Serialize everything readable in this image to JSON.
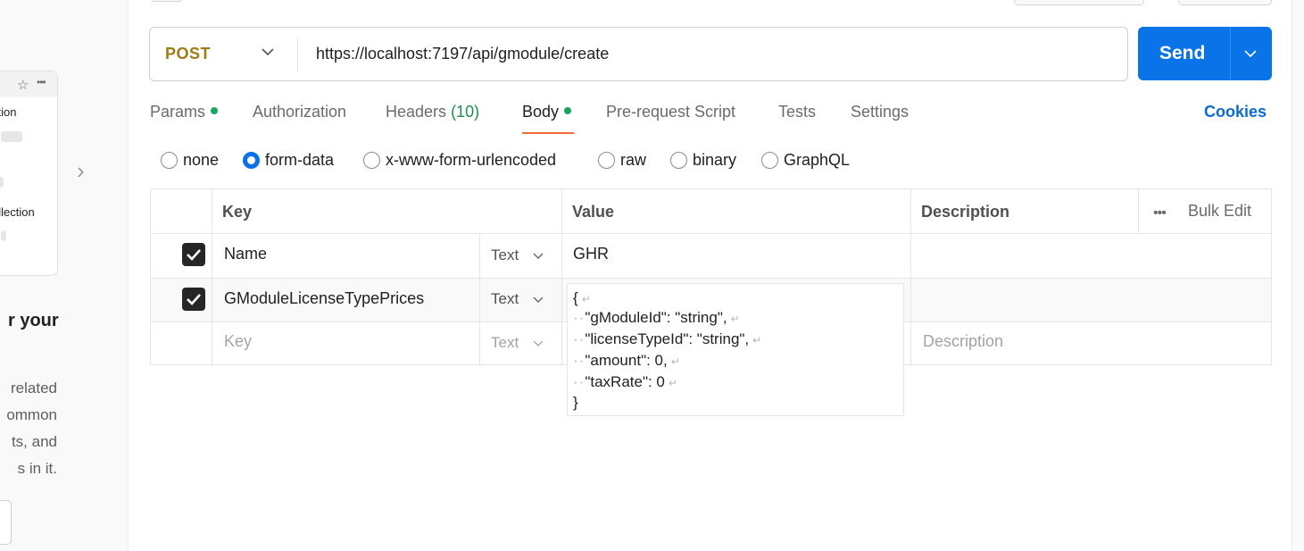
{
  "sidebar": {
    "card_line1": "ction",
    "card_line2": "ollection",
    "title": "r your",
    "desc_lines": [
      "related",
      "ommon",
      "ts, and",
      "s in it."
    ]
  },
  "request": {
    "method": "POST",
    "url": "https://localhost:7197/api/gmodule/create",
    "send_label": "Send"
  },
  "tabs": {
    "params": "Params",
    "authorization": "Authorization",
    "headers": "Headers",
    "headers_count": "(10)",
    "body": "Body",
    "prerequest": "Pre-request Script",
    "tests": "Tests",
    "settings": "Settings",
    "cookies": "Cookies"
  },
  "body_types": {
    "none": "none",
    "form_data": "form-data",
    "urlencoded": "x-www-form-urlencoded",
    "raw": "raw",
    "binary": "binary",
    "graphql": "GraphQL",
    "selected": "form-data"
  },
  "table": {
    "headers": {
      "key": "Key",
      "value": "Value",
      "description": "Description",
      "bulk_edit": "Bulk Edit"
    },
    "rows": [
      {
        "checked": true,
        "key": "Name",
        "type": "Text",
        "value": "GHR"
      },
      {
        "checked": true,
        "key": "GModuleLicenseTypePrices",
        "type": "Text",
        "value": ""
      }
    ],
    "empty_row": {
      "key_placeholder": "Key",
      "type": "Text",
      "description_placeholder": "Description"
    }
  },
  "json_value": {
    "open": "{",
    "line1": "\"gModuleId\": \"string\",",
    "line2": "\"licenseTypeId\": \"string\",",
    "line3": "\"amount\": 0,",
    "line4": "\"taxRate\": 0",
    "close": "}"
  },
  "colors": {
    "accent": "#0a73e8",
    "method": "#a07a12",
    "active_tab_underline": "#f26b3a",
    "status_dot": "#1aa55d"
  }
}
